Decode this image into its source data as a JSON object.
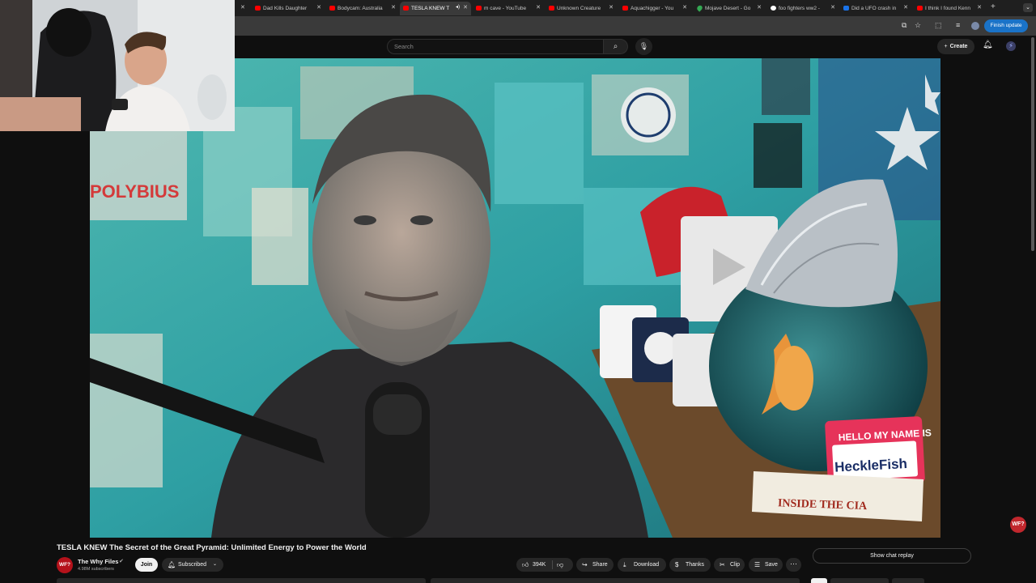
{
  "browser": {
    "tabs": [
      {
        "label": "Dad Kills Daughter",
        "type": "yt"
      },
      {
        "label": "Bodycam: Australia",
        "type": "yt"
      },
      {
        "label": "TESLA KNEW T",
        "type": "yt",
        "active": true
      },
      {
        "label": "m cave - YouTube",
        "type": "yt"
      },
      {
        "label": "Unknown Creature",
        "type": "yt"
      },
      {
        "label": "Aquachigger - You",
        "type": "yt"
      },
      {
        "label": "Mojave Desert - Go",
        "type": "maps"
      },
      {
        "label": "foo fighters ww2 -",
        "type": "google"
      },
      {
        "label": "Did a UFO crash in",
        "type": "m"
      },
      {
        "label": "I think I found Kenn",
        "type": "yt"
      }
    ],
    "finish_update_label": "Finish update"
  },
  "youtube": {
    "search_placeholder": "Search",
    "create_label": "Create",
    "video": {
      "title": "TESLA KNEW The Secret of the Great Pyramid: Unlimited Energy to Power the World",
      "watermark": "WF?",
      "poster_text": "POLYBIUS",
      "sign_text": "HELLO MY NAME IS",
      "sign_name": "HeckleFish",
      "book_title": "INSIDE THE CIA"
    },
    "channel": {
      "avatar_text": "WF?",
      "name": "The Why Files",
      "subscribers": "4.98M subscribers",
      "join_label": "Join",
      "subscribed_label": "Subscribed"
    },
    "actions": {
      "likes": "394K",
      "share": "Share",
      "download": "Download",
      "thanks": "Thanks",
      "clip": "Clip",
      "save": "Save"
    },
    "chat_replay_label": "Show chat replay"
  },
  "colors": {
    "page_bg": "#0f0f0f",
    "accent_blue": "#1a73c8",
    "yt_red": "#ff0000"
  }
}
